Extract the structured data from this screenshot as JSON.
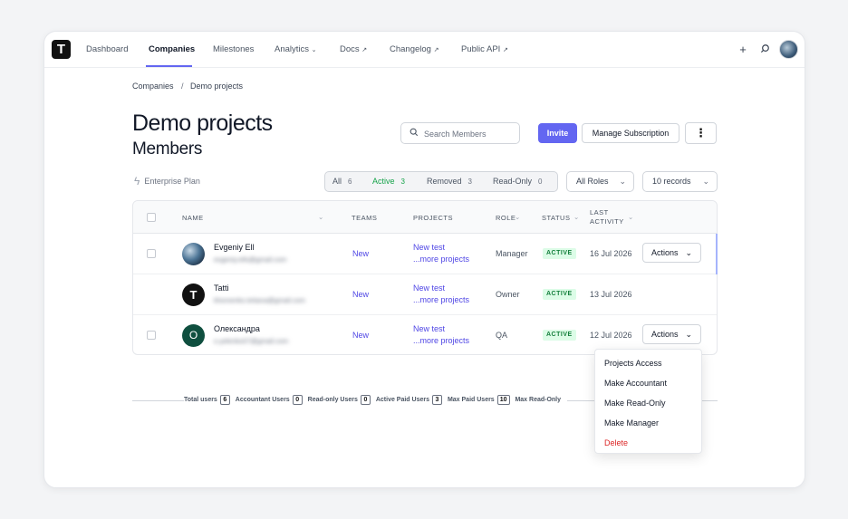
{
  "nav": {
    "logo": "T",
    "items": [
      {
        "label": "Dashboard"
      },
      {
        "label": "Companies"
      },
      {
        "label": "Milestones"
      },
      {
        "label": "Analytics"
      },
      {
        "label": "Docs"
      },
      {
        "label": "Changelog"
      },
      {
        "label": "Public API"
      }
    ],
    "active": "Companies",
    "icons": [
      "plus-icon",
      "search-icon",
      "avatar"
    ]
  },
  "breadcrumb": {
    "parent": "Companies",
    "sep": "/",
    "current": "Demo projects"
  },
  "page": {
    "title": "Demo projects",
    "subtitle": "Members"
  },
  "toolbar": {
    "search_placeholder": "Search Members",
    "invite_label": "Invite",
    "manage_label": "Manage Subscription",
    "more_label": "⋮"
  },
  "plan": {
    "label": "Enterprise Plan"
  },
  "filters": [
    {
      "label": "All",
      "count": "6"
    },
    {
      "label": "Active",
      "count": "3"
    },
    {
      "label": "Removed",
      "count": "3"
    },
    {
      "label": "Read-Only",
      "count": "0"
    }
  ],
  "roles_dropdown": "All Roles",
  "records_dropdown": "10 records",
  "table": {
    "headers": {
      "name": "NAME",
      "teams": "TEAMS",
      "projects": "PROJECTS",
      "role": "ROLE",
      "status": "STATUS",
      "last_activity_1": "LAST",
      "last_activity_2": "ACTIVITY"
    },
    "rows": [
      {
        "name": "Evgeniy Ell",
        "email": "evgeniy.ells@gmail.com",
        "team": "New",
        "project": "New test",
        "more": "...more projects",
        "role": "Manager",
        "status": "ACTIVE",
        "date": "16 Jul 2026",
        "actions": "Actions",
        "avatar": ""
      },
      {
        "name": "Tatti",
        "email": "khomenko.tetiana@gmail.com",
        "team": "New",
        "project": "New test",
        "more": "...more projects",
        "role": "Owner",
        "status": "ACTIVE",
        "date": "13 Jul 2026",
        "actions": "",
        "avatar": "T"
      },
      {
        "name": "Олександра",
        "email": "o.yelenko07@gmail.com",
        "team": "New",
        "project": "New test",
        "more": "...more projects",
        "role": "QA",
        "status": "ACTIVE",
        "date": "12 Jul 2026",
        "actions": "Actions",
        "avatar": "O"
      }
    ]
  },
  "stats": [
    {
      "label": "Total users",
      "value": "6"
    },
    {
      "label": "Accountant Users",
      "value": "0"
    },
    {
      "label": "Read-only Users",
      "value": "0"
    },
    {
      "label": "Active Paid Users",
      "value": "3"
    },
    {
      "label": "Max Paid Users",
      "value": "10"
    },
    {
      "label": "Max Read-Only",
      "value": ""
    }
  ],
  "menu": [
    {
      "label": "Projects Access"
    },
    {
      "label": "Make Accountant"
    },
    {
      "label": "Make Read-Only"
    },
    {
      "label": "Make Manager"
    },
    {
      "label": "Delete"
    }
  ],
  "colors": {
    "accent": "#6366f1",
    "status_bg": "#dcfce7",
    "status_text": "#15803d",
    "danger": "#dc2626"
  }
}
